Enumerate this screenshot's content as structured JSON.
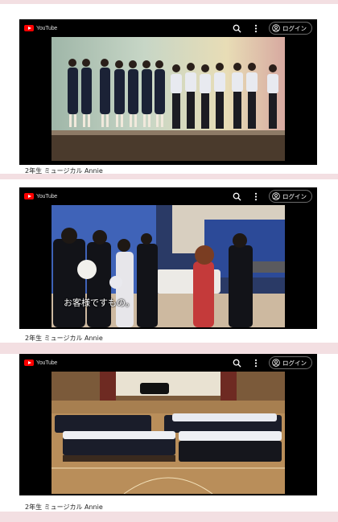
{
  "videos": [
    {
      "logo_text": "YouTube",
      "login_label": "ログイン",
      "caption": "2年生 ミュージカル Annie",
      "subtitle": ""
    },
    {
      "logo_text": "YouTube",
      "login_label": "ログイン",
      "caption": "2年生 ミュージカル Annie",
      "subtitle": "お客様ですもの。"
    },
    {
      "logo_text": "YouTube",
      "login_label": "ログイン",
      "caption": "2年生 ミュージカル Annie",
      "subtitle": ""
    }
  ],
  "icons": [
    "youtube-logo-icon",
    "search-icon",
    "more-vert-icon",
    "account-icon"
  ]
}
